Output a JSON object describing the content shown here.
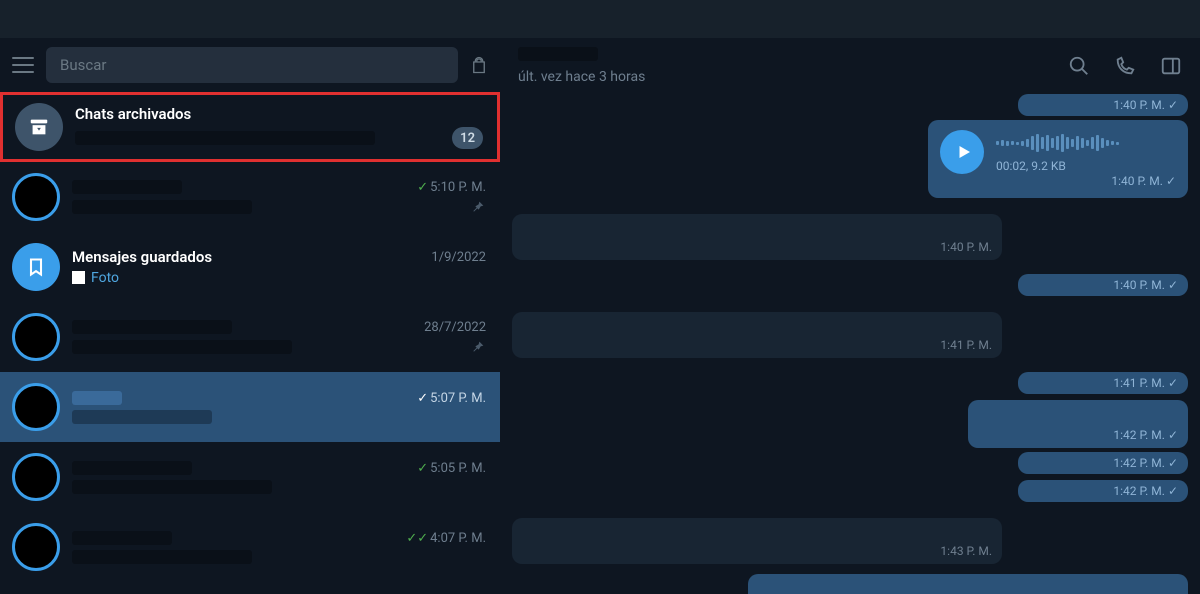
{
  "search": {
    "placeholder": "Buscar"
  },
  "archived": {
    "label": "Chats archivados",
    "count": "12"
  },
  "chats": [
    {
      "time": "5:10 P. M.",
      "checks": "single",
      "pinned": true
    },
    {
      "title": "Mensajes guardados",
      "sub_prefix": "Foto",
      "time": "1/9/2022"
    },
    {
      "time": "28/7/2022",
      "pinned": true
    },
    {
      "time": "5:07 P. M.",
      "checks": "single",
      "selected": true
    },
    {
      "time": "5:05 P. M.",
      "checks": "single"
    },
    {
      "time": "4:07 P. M.",
      "checks": "double"
    }
  ],
  "header": {
    "status": "últ. vez hace 3 horas"
  },
  "voice": {
    "meta": "00:02, 9.2 KB",
    "time": "1:40 P. M."
  },
  "msg_times": {
    "t140a": "1:40 P. M.",
    "t140b": "1:40 P. M.",
    "t140c": "1:40 P. M.",
    "t140d": "1:40 P. M.",
    "t141": "1:41 P. M.",
    "t141b": "1:41 P. M.",
    "t142a": "1:42 P. M.",
    "t142b": "1:42 P. M.",
    "t142c": "1:42 P. M.",
    "t143": "1:43 P. M."
  }
}
